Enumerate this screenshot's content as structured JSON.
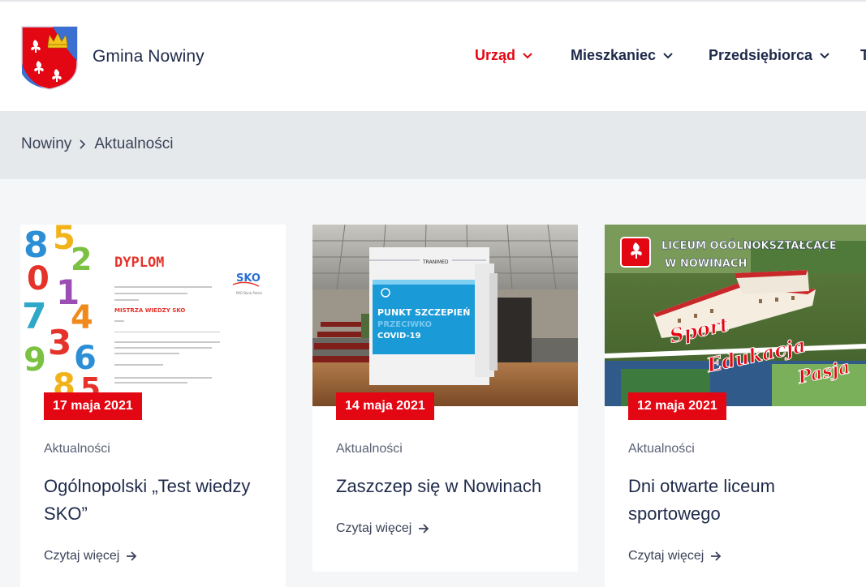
{
  "header": {
    "brand": "Gmina Nowiny",
    "nav": [
      {
        "label": "Urząd",
        "active": true
      },
      {
        "label": "Mieszkaniec",
        "active": false
      },
      {
        "label": "Przedsiębiorca",
        "active": false
      },
      {
        "label": "T",
        "active": false
      }
    ]
  },
  "breadcrumb": {
    "home": "Nowiny",
    "current": "Aktualności"
  },
  "cards": [
    {
      "date": "17 maja 2021",
      "category": "Aktualności",
      "title": "Ogólnopolski „Test wiedzy SKO”",
      "read_more": "Czytaj więcej",
      "image": {
        "heading": "DYPLOM",
        "logo": "SKO",
        "logo_sub": "PKO Bank Polski",
        "award": "MISTRZA WIEDZY SKO",
        "digits": "8520147369"
      }
    },
    {
      "date": "14 maja 2021",
      "category": "Aktualności",
      "title": "Zaszczep się w Nowinach",
      "read_more": "Czytaj więcej",
      "image": {
        "booth_brand": "TRANIMED",
        "sign_line1": "PUNKT SZCZEPIEŃ",
        "sign_line2": "PRZECIWKO",
        "sign_line3": "COVID-19"
      }
    },
    {
      "date": "12 maja 2021",
      "category": "Aktualności",
      "title": "Dni otwarte liceum sportowego",
      "read_more": "Czytaj więcej",
      "image": {
        "line1": "LICEUM OGÓLNOKSZTAŁCĄCE",
        "line2": "W NOWINACH",
        "script1": "Sport",
        "script2": "Edukacja",
        "script3": "Pasja"
      }
    }
  ],
  "colors": {
    "accent": "#e30613",
    "text": "#1e2a4a",
    "breadcrumb_bg": "#e6e9ec",
    "page_bg": "#f5f6f8"
  },
  "icons": [
    "crest-icon",
    "chevron-down-icon",
    "chevron-right-icon",
    "arrow-right-icon"
  ]
}
